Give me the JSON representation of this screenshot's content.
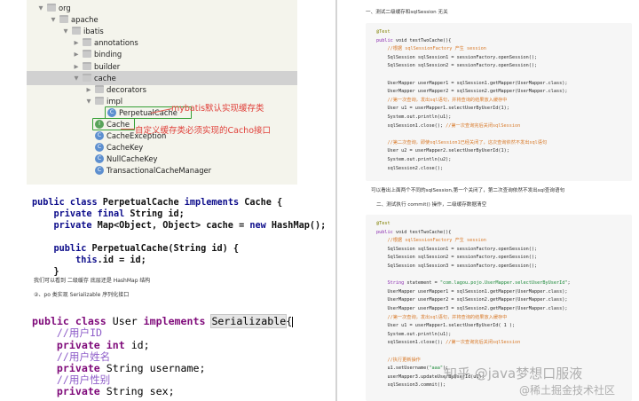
{
  "tree": [
    {
      "label": "org",
      "indent": 0,
      "type": "folder",
      "open": true
    },
    {
      "label": "apache",
      "indent": 1,
      "type": "folder",
      "open": true
    },
    {
      "label": "ibatis",
      "indent": 2,
      "type": "folder",
      "open": true
    },
    {
      "label": "annotations",
      "indent": 3,
      "type": "folder",
      "open": false
    },
    {
      "label": "binding",
      "indent": 3,
      "type": "folder",
      "open": false
    },
    {
      "label": "builder",
      "indent": 3,
      "type": "folder",
      "open": false
    },
    {
      "label": "cache",
      "indent": 3,
      "type": "folder",
      "open": true,
      "selected": true
    },
    {
      "label": "decorators",
      "indent": 4,
      "type": "folder",
      "open": false
    },
    {
      "label": "impl",
      "indent": 4,
      "type": "folder",
      "open": true
    },
    {
      "label": "PerpetualCache",
      "indent": 5,
      "type": "class",
      "boxed": true
    },
    {
      "label": "Cache",
      "indent": 4,
      "type": "iface",
      "boxed": true
    },
    {
      "label": "CacheException",
      "indent": 4,
      "type": "class"
    },
    {
      "label": "CacheKey",
      "indent": 4,
      "type": "class"
    },
    {
      "label": "NullCacheKey",
      "indent": 4,
      "type": "class"
    },
    {
      "label": "TransactionalCacheManager",
      "indent": 4,
      "type": "class"
    }
  ],
  "annotations": {
    "impl_note": "mybatis默认实现缓存类",
    "cache_note": "自定义缓存类必须实现的Cacho接口"
  },
  "code1": {
    "l1a": "public class ",
    "l1b": "PerpetualCache ",
    "l1c": "implements ",
    "l1d": "Cache {",
    "l2a": "    private final ",
    "l2b": "String id;",
    "l3a": "    private ",
    "l3b": "Map<Object, Object> cache = ",
    "l3c": "new ",
    "l3d": "HashMap();",
    "l4a": "    public ",
    "l4b": "PerpetualCache(String id) {",
    "l5a": "        this",
    "l5b": ".id = id;",
    "l6": "    }"
  },
  "notes": {
    "n1": "我们可以看到 二级缓存 底层还是 HashMap 结构",
    "n2": "②、po 类实现 Serializable 序列化接口"
  },
  "code2": {
    "l1a": "public class ",
    "l1b": "User ",
    "l1c": "implements ",
    "l1d": "Serializable",
    "l1e": "{",
    "c1": "    //用户ID",
    "l2a": "    private ",
    "l2b": "int ",
    "l2c": "id;",
    "c2": "    //用户姓名",
    "l3a": "    private ",
    "l3b": "String username;",
    "c3": "    //用户性别",
    "l4a": "    private ",
    "l4b": "String sex;"
  },
  "right": {
    "h1": "一、测试二级缓存和sqlSession 无关",
    "mid": "可以看出上面两个不同的sqlSession,第一个关闭了，第二次查询依然不发出sql查询语句",
    "h2": "二、测试执行 commit() 操作，二级缓存数据清空",
    "b1": [
      "@Test",
      "public void testTwoCache(){",
      "    //根据 sqlSessionFactory 产生 session",
      "    SqlSession sqlSession1 = sessionFactory.openSession();",
      "    SqlSession sqlSession2 = sessionFactory.openSession();",
      "",
      "    UserMapper userMapper1 = sqlSession1.getMapper(UserMapper.class);",
      "    UserMapper userMapper2 = sqlSession2.getMapper(UserMapper.class);",
      "    //第一次查询，发出sql语句，并将查询的结果放入缓存中",
      "    User u1 = userMapper1.selectUserByUserId(1);",
      "    System.out.println(u1);",
      "    sqlSession1.close(); //第一次查询完后关闭sqlSession",
      "",
      "    //第二次查询，即使sqlSession1已经关闭了，这次查询依然不发出sql语句",
      "    User u2 = userMapper2.selectUserByUserId(1);",
      "    System.out.println(u2);",
      "    sqlSession2.close();"
    ],
    "b2": [
      "@Test",
      "public void testTwoCache(){",
      "    //根据 sqlSessionFactory 产生 session",
      "    SqlSession sqlSession1 = sessionFactory.openSession();",
      "    SqlSession sqlSession2 = sessionFactory.openSession();",
      "    SqlSession sqlSession3 = sessionFactory.openSession();",
      "",
      "    String statement = \"com.lagou.pojo.UserMapper.selectUserByUserId\";",
      "    UserMapper userMapper1 = sqlSession1.getMapper(UserMapper.class);",
      "    UserMapper userMapper2 = sqlSession2.getMapper(UserMapper.class);",
      "    UserMapper userMapper3 = sqlSession2.getMapper(UserMapper.class);",
      "    //第一次查询，发出sql语句，并将查询的结果放入缓存中",
      "    User u1 = userMapper1.selectUserByUserId( 1 );",
      "    System.out.println(u1);",
      "    sqlSession1.close(); //第一次查询完后关闭sqlSession",
      "",
      "    //执行更新操作",
      "    u1.setUsername(\"aaa\");",
      "    userMapper3.updateUserByUserId(u1);",
      "    sqlSession3.commit();"
    ]
  },
  "watermark": {
    "w1": "知乎 @java梦想口服液",
    "w2": "@稀土掘金技术社区"
  }
}
